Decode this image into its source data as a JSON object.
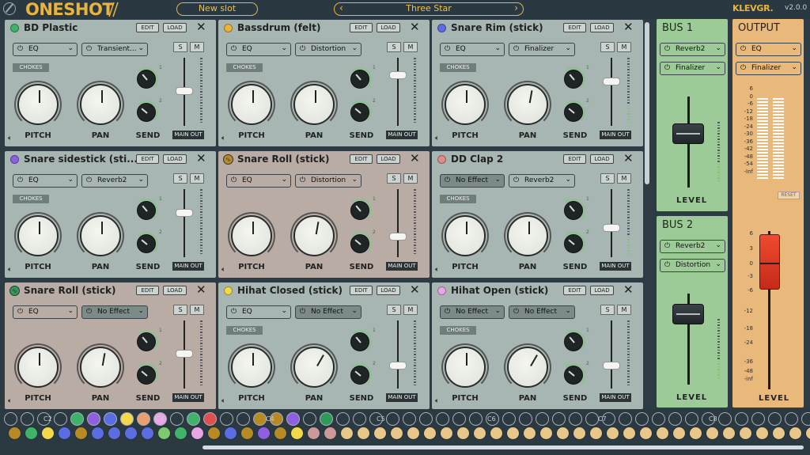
{
  "header": {
    "new_slot": "New slot",
    "preset": "Three Star",
    "brand": "KLEVGR.",
    "version": "v2.0.0",
    "logo": "ONESHOT",
    "prev_icon": "chevron-left",
    "next_icon": "chevron-right"
  },
  "slot_labels": {
    "edit": "EDIT",
    "load": "LOAD",
    "chokes": "CHOKES",
    "solo": "S",
    "mute": "M",
    "pitch": "PITCH",
    "pan": "PAN",
    "send": "SEND",
    "main_out": "MAIN OUT",
    "send1": "1",
    "send2": "2"
  },
  "slots": [
    {
      "name": "BD Plastic",
      "color": "#3fb36a",
      "fx1": "EQ",
      "fx2": "Transient...",
      "chokes": true
    },
    {
      "name": "Bassdrum (felt)",
      "color": "#e8b43f",
      "fx1": "EQ",
      "fx2": "Distortion",
      "chokes": true
    },
    {
      "name": "Snare Rim (stick)",
      "color": "#5b6de0",
      "fx1": "EQ",
      "fx2": "Finalizer",
      "chokes": true
    },
    {
      "name": "Snare sidestick (sti...",
      "color": "#8e5fe0",
      "fx1": "EQ",
      "fx2": "Reverb2",
      "chokes": true
    },
    {
      "name": "Snare Roll (stick)",
      "color": "#b88a24",
      "fx1": "EQ",
      "fx2": "Distortion",
      "chokes": false
    },
    {
      "name": "DD Clap 2",
      "color": "#e08c8a",
      "fx1": "No Effect",
      "fx2": "Reverb2",
      "chokes": true
    },
    {
      "name": "Snare Roll (stick)",
      "color": "#2d9a5a",
      "fx1": "EQ",
      "fx2": "No Effect",
      "chokes": false
    },
    {
      "name": "Hihat Closed (stick)",
      "color": "#f3d94a",
      "fx1": "EQ",
      "fx2": "No Effect",
      "chokes": true
    },
    {
      "name": "Hihat Open (stick)",
      "color": "#e8a6e6",
      "fx1": "No Effect",
      "fx2": "No Effect",
      "chokes": true
    }
  ],
  "bus1": {
    "title": "BUS 1",
    "fx1": "Reverb2",
    "fx2": "Finalizer",
    "level": "LEVEL"
  },
  "bus2": {
    "title": "BUS 2",
    "fx1": "Reverb2",
    "fx2": "Distortion",
    "level": "LEVEL"
  },
  "output": {
    "title": "OUTPUT",
    "fx1": "EQ",
    "fx2": "Finalizer",
    "reset": "RESET",
    "level": "LEVEL",
    "meter_scale": [
      "6",
      "0",
      "-6",
      "-12",
      "-18",
      "-24",
      "-30",
      "-36",
      "-42",
      "-48",
      "-54",
      "-Inf"
    ],
    "fader_scale": [
      "6",
      "3",
      "0",
      "-3",
      "-6",
      "-12",
      "-18",
      "-24",
      "-36",
      "-48",
      "-inf"
    ]
  },
  "octaves": [
    "C2",
    "C3",
    "C4",
    "C5",
    "C6",
    "C7",
    "C8"
  ]
}
